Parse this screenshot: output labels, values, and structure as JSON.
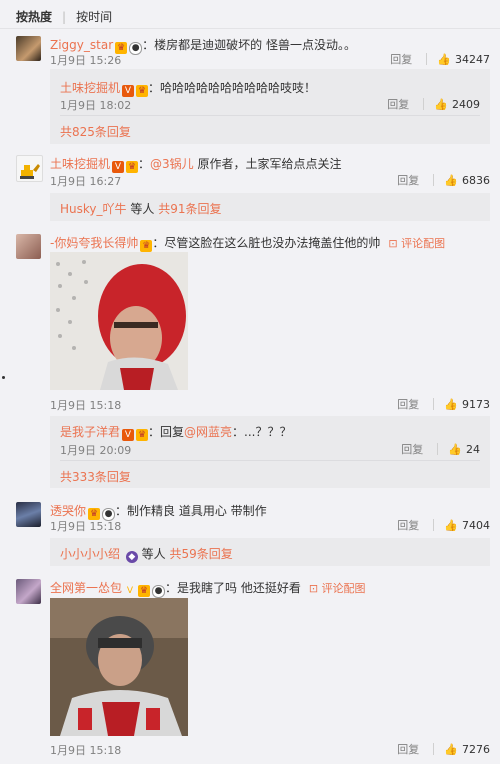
{
  "sort": {
    "hot": "按热度",
    "time": "按时间",
    "separator": "|"
  },
  "common": {
    "reply_label": "回复",
    "view_pic_label": "评论配图",
    "thumb_icon": "thumb-up-icon",
    "accent": "#eb7350"
  },
  "comments": [
    {
      "user": "Ziggy_star",
      "text": "：楼房都是迪迦破坏的 怪兽一点没动。。",
      "time": "1月9日 15:26",
      "likes": "34247",
      "sub": {
        "user": "土味挖掘机",
        "text": "：哈哈哈哈哈哈哈哈哈哈吱吱！",
        "time": "1月9日 18:02",
        "likes": "2409"
      },
      "more": "共825条回复"
    },
    {
      "user": "土味挖掘机",
      "mention": "@3锅儿",
      "text": " 原作者，土家军给点点关注",
      "time": "1月9日 16:27",
      "likes": "6836",
      "replier": "Husky_吖牛",
      "replier_suffix": "等人",
      "more": "共91条回复"
    },
    {
      "user": "-你妈夸我长得帅",
      "text": "：尽管这脸在这么脏也没办法掩盖住他的帅",
      "time": "1月9日 15:18",
      "likes": "9173",
      "sub": {
        "user": "是我子洋君",
        "text_prefix": "：回复",
        "mention": "@网蓝亮",
        "text": "：...？？？",
        "time": "1月9日 20:09",
        "likes": "24"
      },
      "more": "共333条回复"
    },
    {
      "user": "透哭你",
      "text": "：制作精良 道具用心 带制作",
      "time": "1月9日 15:18",
      "likes": "7404",
      "replier": "小小小小绍",
      "replier_suffix": "等人",
      "more": "共59条回复"
    },
    {
      "user": "全网第一怂包",
      "text": "：是我瞎了吗 他还挺好看",
      "time": "1月9日 15:18",
      "likes": "7276"
    }
  ]
}
